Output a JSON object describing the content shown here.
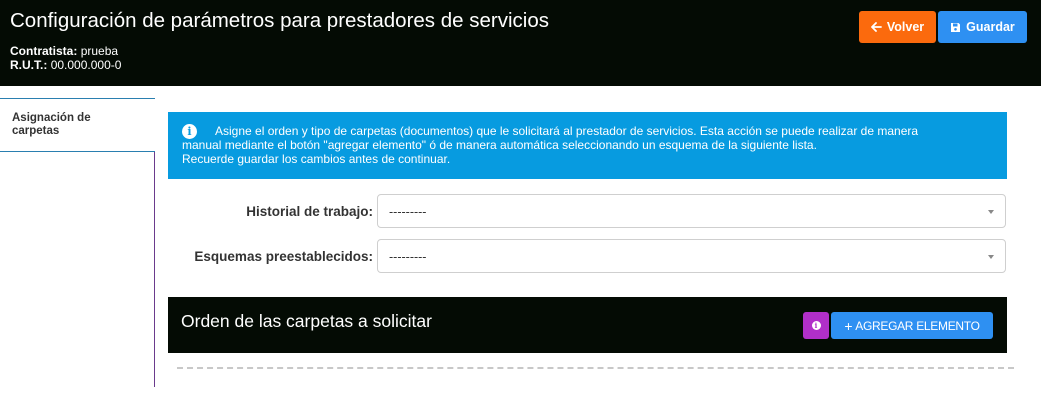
{
  "header": {
    "title": "Configuración de parámetros para prestadores de servicios",
    "contratista_label": "Contratista:",
    "contratista_value": "prueba",
    "rut_label": "R.U.T.:",
    "rut_value": "00.000.000-0",
    "back_label": "Volver",
    "save_label": "Guardar",
    "back_color": "#fb6a0d",
    "save_color": "#2e90f2"
  },
  "sidebar": {
    "items": [
      {
        "label_line1": "Asignación de",
        "label_line2": "carpetas",
        "active": true
      }
    ]
  },
  "info": {
    "line1": "Asigne el orden y tipo de carpetas (documentos) que le solicitará al prestador de servicios. Esta acción se puede realizar de manera",
    "line2": "manual mediante el botón \"agregar elemento\" ó de manera automática seleccionando un esquema de la siguiente lista.",
    "line3": "Recuerde guardar los cambios antes de continuar.",
    "icon": "info-icon",
    "color": "#079be0"
  },
  "form": {
    "historial_label": "Historial de trabajo:",
    "historial_value": "---------",
    "esquemas_label": "Esquemas preestablecidos:",
    "esquemas_value": "---------"
  },
  "panel": {
    "title": "Orden de las carpetas a solicitar",
    "add_label": "AGREGAR ELEMENTO",
    "info_button_color": "#b12fc9"
  }
}
